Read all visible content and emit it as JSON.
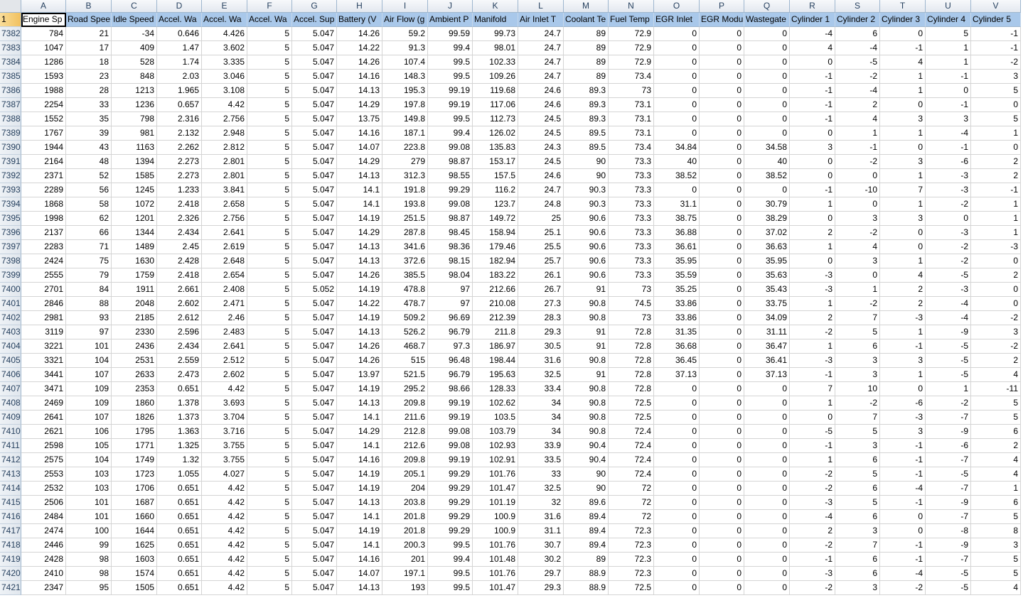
{
  "columns": [
    "A",
    "B",
    "C",
    "D",
    "E",
    "F",
    "G",
    "H",
    "I",
    "J",
    "K",
    "L",
    "M",
    "N",
    "O",
    "P",
    "Q",
    "R",
    "S",
    "T",
    "U",
    "V"
  ],
  "header_row_number": "1",
  "headers": [
    "Engine Sp",
    "Road Spee",
    "Idle Speed",
    "Accel. Wa",
    "Accel. Wa",
    "Accel. Wa",
    "Accel. Sup",
    "Battery (V",
    "Air Flow (g",
    "Ambient P",
    "Manifold",
    "Air Inlet T",
    "Coolant Te",
    "Fuel Temp",
    "EGR Inlet",
    "EGR Modu",
    "Wastegate",
    "Cylinder 1",
    "Cylinder 2",
    "Cylinder 3",
    "Cylinder 4",
    "Cylinder 5"
  ],
  "rows": [
    {
      "n": "7382",
      "v": [
        "784",
        "21",
        "-34",
        "0.646",
        "4.426",
        "5",
        "5.047",
        "14.26",
        "59.2",
        "99.59",
        "99.73",
        "24.7",
        "89",
        "72.9",
        "0",
        "0",
        "0",
        "-4",
        "6",
        "0",
        "5",
        "-1"
      ]
    },
    {
      "n": "7383",
      "v": [
        "1047",
        "17",
        "409",
        "1.47",
        "3.602",
        "5",
        "5.047",
        "14.22",
        "91.3",
        "99.4",
        "98.01",
        "24.7",
        "89",
        "72.9",
        "0",
        "0",
        "0",
        "4",
        "-4",
        "-1",
        "1",
        "-1"
      ]
    },
    {
      "n": "7384",
      "v": [
        "1286",
        "18",
        "528",
        "1.74",
        "3.335",
        "5",
        "5.047",
        "14.26",
        "107.4",
        "99.5",
        "102.33",
        "24.7",
        "89",
        "72.9",
        "0",
        "0",
        "0",
        "0",
        "-5",
        "4",
        "1",
        "-2"
      ]
    },
    {
      "n": "7385",
      "v": [
        "1593",
        "23",
        "848",
        "2.03",
        "3.046",
        "5",
        "5.047",
        "14.16",
        "148.3",
        "99.5",
        "109.26",
        "24.7",
        "89",
        "73.4",
        "0",
        "0",
        "0",
        "-1",
        "-2",
        "1",
        "-1",
        "3"
      ]
    },
    {
      "n": "7386",
      "v": [
        "1988",
        "28",
        "1213",
        "1.965",
        "3.108",
        "5",
        "5.047",
        "14.13",
        "195.3",
        "99.19",
        "119.68",
        "24.6",
        "89.3",
        "73",
        "0",
        "0",
        "0",
        "-1",
        "-4",
        "1",
        "0",
        "5"
      ]
    },
    {
      "n": "7387",
      "v": [
        "2254",
        "33",
        "1236",
        "0.657",
        "4.42",
        "5",
        "5.047",
        "14.29",
        "197.8",
        "99.19",
        "117.06",
        "24.6",
        "89.3",
        "73.1",
        "0",
        "0",
        "0",
        "-1",
        "2",
        "0",
        "-1",
        "0"
      ]
    },
    {
      "n": "7388",
      "v": [
        "1552",
        "35",
        "798",
        "2.316",
        "2.756",
        "5",
        "5.047",
        "13.75",
        "149.8",
        "99.5",
        "112.73",
        "24.5",
        "89.3",
        "73.1",
        "0",
        "0",
        "0",
        "-1",
        "4",
        "3",
        "3",
        "5"
      ]
    },
    {
      "n": "7389",
      "v": [
        "1767",
        "39",
        "981",
        "2.132",
        "2.948",
        "5",
        "5.047",
        "14.16",
        "187.1",
        "99.4",
        "126.02",
        "24.5",
        "89.5",
        "73.1",
        "0",
        "0",
        "0",
        "0",
        "1",
        "1",
        "-4",
        "1"
      ]
    },
    {
      "n": "7390",
      "v": [
        "1944",
        "43",
        "1163",
        "2.262",
        "2.812",
        "5",
        "5.047",
        "14.07",
        "223.8",
        "99.08",
        "135.83",
        "24.3",
        "89.5",
        "73.4",
        "34.84",
        "0",
        "34.58",
        "3",
        "-1",
        "0",
        "-1",
        "0"
      ]
    },
    {
      "n": "7391",
      "v": [
        "2164",
        "48",
        "1394",
        "2.273",
        "2.801",
        "5",
        "5.047",
        "14.29",
        "279",
        "98.87",
        "153.17",
        "24.5",
        "90",
        "73.3",
        "40",
        "0",
        "40",
        "0",
        "-2",
        "3",
        "-6",
        "2"
      ]
    },
    {
      "n": "7392",
      "v": [
        "2371",
        "52",
        "1585",
        "2.273",
        "2.801",
        "5",
        "5.047",
        "14.13",
        "312.3",
        "98.55",
        "157.5",
        "24.6",
        "90",
        "73.3",
        "38.52",
        "0",
        "38.52",
        "0",
        "0",
        "1",
        "-3",
        "2"
      ]
    },
    {
      "n": "7393",
      "v": [
        "2289",
        "56",
        "1245",
        "1.233",
        "3.841",
        "5",
        "5.047",
        "14.1",
        "191.8",
        "99.29",
        "116.2",
        "24.7",
        "90.3",
        "73.3",
        "0",
        "0",
        "0",
        "-1",
        "-10",
        "7",
        "-3",
        "-1"
      ]
    },
    {
      "n": "7394",
      "v": [
        "1868",
        "58",
        "1072",
        "2.418",
        "2.658",
        "5",
        "5.047",
        "14.1",
        "193.8",
        "99.08",
        "123.7",
        "24.8",
        "90.3",
        "73.3",
        "31.1",
        "0",
        "30.79",
        "1",
        "0",
        "1",
        "-2",
        "1"
      ]
    },
    {
      "n": "7395",
      "v": [
        "1998",
        "62",
        "1201",
        "2.326",
        "2.756",
        "5",
        "5.047",
        "14.19",
        "251.5",
        "98.87",
        "149.72",
        "25",
        "90.6",
        "73.3",
        "38.75",
        "0",
        "38.29",
        "0",
        "3",
        "3",
        "0",
        "1"
      ]
    },
    {
      "n": "7396",
      "v": [
        "2137",
        "66",
        "1344",
        "2.434",
        "2.641",
        "5",
        "5.047",
        "14.29",
        "287.8",
        "98.45",
        "158.94",
        "25.1",
        "90.6",
        "73.3",
        "36.88",
        "0",
        "37.02",
        "2",
        "-2",
        "0",
        "-3",
        "1"
      ]
    },
    {
      "n": "7397",
      "v": [
        "2283",
        "71",
        "1489",
        "2.45",
        "2.619",
        "5",
        "5.047",
        "14.13",
        "341.6",
        "98.36",
        "179.46",
        "25.5",
        "90.6",
        "73.3",
        "36.61",
        "0",
        "36.63",
        "1",
        "4",
        "0",
        "-2",
        "-3"
      ]
    },
    {
      "n": "7398",
      "v": [
        "2424",
        "75",
        "1630",
        "2.428",
        "2.648",
        "5",
        "5.047",
        "14.13",
        "372.6",
        "98.15",
        "182.94",
        "25.7",
        "90.6",
        "73.3",
        "35.95",
        "0",
        "35.95",
        "0",
        "3",
        "1",
        "-2",
        "0"
      ]
    },
    {
      "n": "7399",
      "v": [
        "2555",
        "79",
        "1759",
        "2.418",
        "2.654",
        "5",
        "5.047",
        "14.26",
        "385.5",
        "98.04",
        "183.22",
        "26.1",
        "90.6",
        "73.3",
        "35.59",
        "0",
        "35.63",
        "-3",
        "0",
        "4",
        "-5",
        "2"
      ]
    },
    {
      "n": "7400",
      "v": [
        "2701",
        "84",
        "1911",
        "2.661",
        "2.408",
        "5",
        "5.052",
        "14.19",
        "478.8",
        "97",
        "212.66",
        "26.7",
        "91",
        "73",
        "35.25",
        "0",
        "35.43",
        "-3",
        "1",
        "2",
        "-3",
        "0"
      ]
    },
    {
      "n": "7401",
      "v": [
        "2846",
        "88",
        "2048",
        "2.602",
        "2.471",
        "5",
        "5.047",
        "14.22",
        "478.7",
        "97",
        "210.08",
        "27.3",
        "90.8",
        "74.5",
        "33.86",
        "0",
        "33.75",
        "1",
        "-2",
        "2",
        "-4",
        "0"
      ]
    },
    {
      "n": "7402",
      "v": [
        "2981",
        "93",
        "2185",
        "2.612",
        "2.46",
        "5",
        "5.047",
        "14.19",
        "509.2",
        "96.69",
        "212.39",
        "28.3",
        "90.8",
        "73",
        "33.86",
        "0",
        "34.09",
        "2",
        "7",
        "-3",
        "-4",
        "-2"
      ]
    },
    {
      "n": "7403",
      "v": [
        "3119",
        "97",
        "2330",
        "2.596",
        "2.483",
        "5",
        "5.047",
        "14.13",
        "526.2",
        "96.79",
        "211.8",
        "29.3",
        "91",
        "72.8",
        "31.35",
        "0",
        "31.11",
        "-2",
        "5",
        "1",
        "-9",
        "3"
      ]
    },
    {
      "n": "7404",
      "v": [
        "3221",
        "101",
        "2436",
        "2.434",
        "2.641",
        "5",
        "5.047",
        "14.26",
        "468.7",
        "97.3",
        "186.97",
        "30.5",
        "91",
        "72.8",
        "36.68",
        "0",
        "36.47",
        "1",
        "6",
        "-1",
        "-5",
        "-2"
      ]
    },
    {
      "n": "7405",
      "v": [
        "3321",
        "104",
        "2531",
        "2.559",
        "2.512",
        "5",
        "5.047",
        "14.26",
        "515",
        "96.48",
        "198.44",
        "31.6",
        "90.8",
        "72.8",
        "36.45",
        "0",
        "36.41",
        "-3",
        "3",
        "3",
        "-5",
        "2"
      ]
    },
    {
      "n": "7406",
      "v": [
        "3441",
        "107",
        "2633",
        "2.473",
        "2.602",
        "5",
        "5.047",
        "13.97",
        "521.5",
        "96.79",
        "195.63",
        "32.5",
        "91",
        "72.8",
        "37.13",
        "0",
        "37.13",
        "-1",
        "3",
        "1",
        "-5",
        "4"
      ]
    },
    {
      "n": "7407",
      "v": [
        "3471",
        "109",
        "2353",
        "0.651",
        "4.42",
        "5",
        "5.047",
        "14.19",
        "295.2",
        "98.66",
        "128.33",
        "33.4",
        "90.8",
        "72.8",
        "0",
        "0",
        "0",
        "7",
        "10",
        "0",
        "1",
        "-11"
      ]
    },
    {
      "n": "7408",
      "v": [
        "2469",
        "109",
        "1860",
        "1.378",
        "3.693",
        "5",
        "5.047",
        "14.13",
        "209.8",
        "99.19",
        "102.62",
        "34",
        "90.8",
        "72.5",
        "0",
        "0",
        "0",
        "1",
        "-2",
        "-6",
        "-2",
        "5"
      ]
    },
    {
      "n": "7409",
      "v": [
        "2641",
        "107",
        "1826",
        "1.373",
        "3.704",
        "5",
        "5.047",
        "14.1",
        "211.6",
        "99.19",
        "103.5",
        "34",
        "90.8",
        "72.5",
        "0",
        "0",
        "0",
        "0",
        "7",
        "-3",
        "-7",
        "5"
      ]
    },
    {
      "n": "7410",
      "v": [
        "2621",
        "106",
        "1795",
        "1.363",
        "3.716",
        "5",
        "5.047",
        "14.29",
        "212.8",
        "99.08",
        "103.79",
        "34",
        "90.8",
        "72.4",
        "0",
        "0",
        "0",
        "-5",
        "5",
        "3",
        "-9",
        "6"
      ]
    },
    {
      "n": "7411",
      "v": [
        "2598",
        "105",
        "1771",
        "1.325",
        "3.755",
        "5",
        "5.047",
        "14.1",
        "212.6",
        "99.08",
        "102.93",
        "33.9",
        "90.4",
        "72.4",
        "0",
        "0",
        "0",
        "-1",
        "3",
        "-1",
        "-6",
        "2"
      ]
    },
    {
      "n": "7412",
      "v": [
        "2575",
        "104",
        "1749",
        "1.32",
        "3.755",
        "5",
        "5.047",
        "14.16",
        "209.8",
        "99.19",
        "102.91",
        "33.5",
        "90.4",
        "72.4",
        "0",
        "0",
        "0",
        "1",
        "6",
        "-1",
        "-7",
        "4"
      ]
    },
    {
      "n": "7413",
      "v": [
        "2553",
        "103",
        "1723",
        "1.055",
        "4.027",
        "5",
        "5.047",
        "14.19",
        "205.1",
        "99.29",
        "101.76",
        "33",
        "90",
        "72.4",
        "0",
        "0",
        "0",
        "-2",
        "5",
        "-1",
        "-5",
        "4"
      ]
    },
    {
      "n": "7414",
      "v": [
        "2532",
        "103",
        "1706",
        "0.651",
        "4.42",
        "5",
        "5.047",
        "14.19",
        "204",
        "99.29",
        "101.47",
        "32.5",
        "90",
        "72",
        "0",
        "0",
        "0",
        "-2",
        "6",
        "-4",
        "-7",
        "1"
      ]
    },
    {
      "n": "7415",
      "v": [
        "2506",
        "101",
        "1687",
        "0.651",
        "4.42",
        "5",
        "5.047",
        "14.13",
        "203.8",
        "99.29",
        "101.19",
        "32",
        "89.6",
        "72",
        "0",
        "0",
        "0",
        "-3",
        "5",
        "-1",
        "-9",
        "6"
      ]
    },
    {
      "n": "7416",
      "v": [
        "2484",
        "101",
        "1660",
        "0.651",
        "4.42",
        "5",
        "5.047",
        "14.1",
        "201.8",
        "99.29",
        "100.9",
        "31.6",
        "89.4",
        "72",
        "0",
        "0",
        "0",
        "-4",
        "6",
        "0",
        "-7",
        "5"
      ]
    },
    {
      "n": "7417",
      "v": [
        "2474",
        "100",
        "1644",
        "0.651",
        "4.42",
        "5",
        "5.047",
        "14.19",
        "201.8",
        "99.29",
        "100.9",
        "31.1",
        "89.4",
        "72.3",
        "0",
        "0",
        "0",
        "2",
        "3",
        "0",
        "-8",
        "8"
      ]
    },
    {
      "n": "7418",
      "v": [
        "2446",
        "99",
        "1625",
        "0.651",
        "4.42",
        "5",
        "5.047",
        "14.1",
        "200.3",
        "99.5",
        "101.76",
        "30.7",
        "89.4",
        "72.3",
        "0",
        "0",
        "0",
        "-2",
        "7",
        "-1",
        "-9",
        "3"
      ]
    },
    {
      "n": "7419",
      "v": [
        "2428",
        "98",
        "1603",
        "0.651",
        "4.42",
        "5",
        "5.047",
        "14.16",
        "201",
        "99.4",
        "101.48",
        "30.2",
        "89",
        "72.3",
        "0",
        "0",
        "0",
        "-1",
        "6",
        "-1",
        "-7",
        "5"
      ]
    },
    {
      "n": "7420",
      "v": [
        "2410",
        "98",
        "1574",
        "0.651",
        "4.42",
        "5",
        "5.047",
        "14.07",
        "197.1",
        "99.5",
        "101.76",
        "29.7",
        "88.9",
        "72.3",
        "0",
        "0",
        "0",
        "-3",
        "6",
        "-4",
        "-5",
        "5"
      ]
    },
    {
      "n": "7421",
      "v": [
        "2347",
        "95",
        "1505",
        "0.651",
        "4.42",
        "5",
        "5.047",
        "14.13",
        "193",
        "99.5",
        "101.47",
        "29.3",
        "88.9",
        "72.5",
        "0",
        "0",
        "0",
        "-2",
        "3",
        "-2",
        "-5",
        "4"
      ]
    }
  ]
}
